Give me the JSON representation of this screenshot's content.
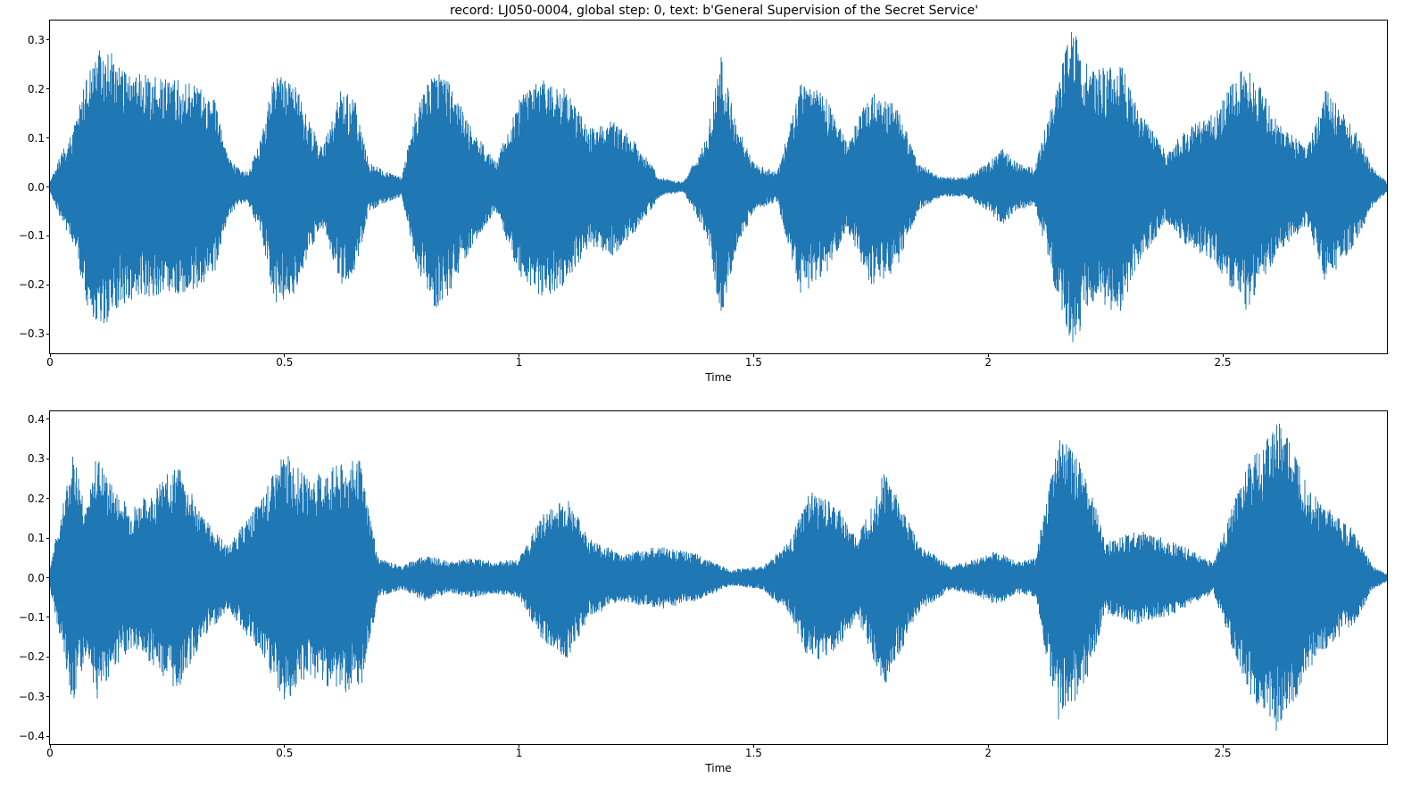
{
  "title": "record: LJ050-0004, global step: 0, text: b'General Supervision of the Secret Service'",
  "colors": {
    "waveform": "#1f77b4",
    "axis": "#000000"
  },
  "panels": [
    {
      "id": "top",
      "xlabel": "Time",
      "xlim": [
        0,
        2.85
      ],
      "ylim": [
        -0.34,
        0.34
      ],
      "xticks": [
        0,
        0.5,
        1.0,
        1.5,
        2.0,
        2.5
      ],
      "xtick_labels": [
        "0",
        "0.5",
        "1",
        "1.5",
        "2",
        "2.5"
      ],
      "yticks": [
        -0.3,
        -0.2,
        -0.1,
        0.0,
        0.1,
        0.2,
        0.3
      ],
      "ytick_labels": [
        "−0.3",
        "−0.2",
        "−0.1",
        "0.0",
        "0.1",
        "0.2",
        "0.3"
      ]
    },
    {
      "id": "bottom",
      "xlabel": "Time",
      "xlim": [
        0,
        2.85
      ],
      "ylim": [
        -0.42,
        0.42
      ],
      "xticks": [
        0,
        0.5,
        1.0,
        1.5,
        2.0,
        2.5
      ],
      "xtick_labels": [
        "0",
        "0.5",
        "1",
        "1.5",
        "2",
        "2.5"
      ],
      "yticks": [
        -0.4,
        -0.3,
        -0.2,
        -0.1,
        0.0,
        0.1,
        0.2,
        0.3,
        0.4
      ],
      "ytick_labels": [
        "−0.4",
        "−0.3",
        "−0.2",
        "−0.1",
        "0.0",
        "0.1",
        "0.2",
        "0.3",
        "0.4"
      ]
    }
  ],
  "chart_data": [
    {
      "type": "line",
      "panel": "top",
      "title": "record: LJ050-0004, global step: 0, text: b'General Supervision of the Secret Service'",
      "xlabel": "Time",
      "ylabel": "",
      "xlim": [
        0,
        2.85
      ],
      "ylim": [
        -0.34,
        0.34
      ],
      "description": "Audio waveform envelope (approximate peak amplitude vs time)",
      "series": [
        {
          "name": "waveform-envelope",
          "x": [
            0.0,
            0.02,
            0.05,
            0.08,
            0.1,
            0.13,
            0.15,
            0.2,
            0.25,
            0.3,
            0.35,
            0.38,
            0.4,
            0.42,
            0.45,
            0.48,
            0.52,
            0.55,
            0.58,
            0.62,
            0.65,
            0.68,
            0.72,
            0.75,
            0.78,
            0.82,
            0.85,
            0.9,
            0.95,
            1.0,
            1.05,
            1.1,
            1.15,
            1.2,
            1.25,
            1.3,
            1.35,
            1.4,
            1.43,
            1.46,
            1.5,
            1.55,
            1.6,
            1.65,
            1.7,
            1.75,
            1.8,
            1.85,
            1.9,
            1.95,
            2.0,
            2.03,
            2.06,
            2.1,
            2.14,
            2.18,
            2.22,
            2.28,
            2.32,
            2.38,
            2.42,
            2.48,
            2.55,
            2.62,
            2.68,
            2.72,
            2.78,
            2.82,
            2.85
          ],
          "values": [
            0.01,
            0.06,
            0.12,
            0.25,
            0.28,
            0.28,
            0.24,
            0.23,
            0.22,
            0.22,
            0.18,
            0.06,
            0.04,
            0.03,
            0.1,
            0.24,
            0.22,
            0.14,
            0.08,
            0.2,
            0.18,
            0.05,
            0.03,
            0.02,
            0.16,
            0.25,
            0.22,
            0.12,
            0.05,
            0.18,
            0.23,
            0.2,
            0.12,
            0.14,
            0.09,
            0.02,
            0.01,
            0.1,
            0.27,
            0.14,
            0.05,
            0.03,
            0.22,
            0.19,
            0.09,
            0.2,
            0.18,
            0.05,
            0.02,
            0.02,
            0.05,
            0.08,
            0.05,
            0.04,
            0.2,
            0.33,
            0.24,
            0.26,
            0.16,
            0.07,
            0.12,
            0.15,
            0.26,
            0.13,
            0.08,
            0.2,
            0.12,
            0.04,
            0.01
          ]
        }
      ]
    },
    {
      "type": "line",
      "panel": "bottom",
      "title": "",
      "xlabel": "Time",
      "ylabel": "",
      "xlim": [
        0,
        2.85
      ],
      "ylim": [
        -0.42,
        0.42
      ],
      "description": "Audio waveform envelope (approximate peak amplitude vs time)",
      "series": [
        {
          "name": "waveform-envelope",
          "x": [
            0.0,
            0.03,
            0.05,
            0.08,
            0.1,
            0.13,
            0.17,
            0.22,
            0.27,
            0.33,
            0.38,
            0.45,
            0.5,
            0.55,
            0.6,
            0.66,
            0.7,
            0.75,
            0.8,
            0.85,
            0.9,
            0.95,
            1.0,
            1.05,
            1.1,
            1.15,
            1.22,
            1.3,
            1.38,
            1.45,
            1.52,
            1.58,
            1.62,
            1.68,
            1.72,
            1.78,
            1.85,
            1.92,
            1.98,
            2.02,
            2.06,
            2.1,
            2.15,
            2.2,
            2.25,
            2.32,
            2.4,
            2.48,
            2.55,
            2.62,
            2.7,
            2.78,
            2.82,
            2.85
          ],
          "values": [
            0.03,
            0.2,
            0.33,
            0.18,
            0.32,
            0.24,
            0.18,
            0.22,
            0.29,
            0.15,
            0.08,
            0.2,
            0.32,
            0.25,
            0.28,
            0.3,
            0.05,
            0.03,
            0.06,
            0.04,
            0.05,
            0.04,
            0.05,
            0.16,
            0.21,
            0.1,
            0.06,
            0.08,
            0.06,
            0.02,
            0.03,
            0.1,
            0.22,
            0.18,
            0.1,
            0.28,
            0.09,
            0.03,
            0.05,
            0.07,
            0.04,
            0.05,
            0.36,
            0.3,
            0.09,
            0.12,
            0.09,
            0.04,
            0.28,
            0.4,
            0.2,
            0.12,
            0.03,
            0.01
          ]
        }
      ]
    }
  ]
}
